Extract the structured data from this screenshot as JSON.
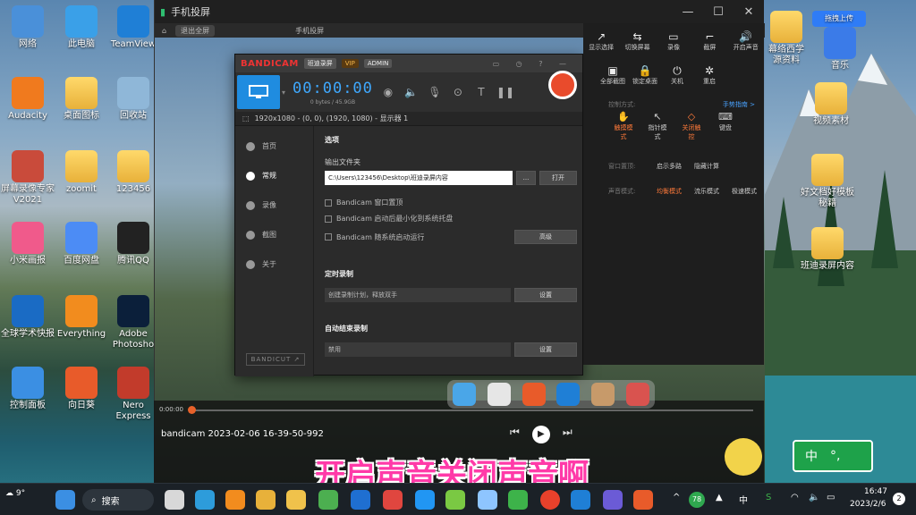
{
  "desktop": {
    "icons_left": [
      {
        "label": "网络",
        "glyph": "net-icon"
      },
      {
        "label": "此电脑",
        "glyph": "pc-icon"
      },
      {
        "label": "TeamView",
        "glyph": "teamviewer-icon"
      },
      {
        "label": "Audacity",
        "glyph": "audacity-icon"
      },
      {
        "label": "桌面图标",
        "glyph": "folder-icon"
      },
      {
        "label": "回收站",
        "glyph": "recycle-icon"
      },
      {
        "label": "屏幕录像专家V2021",
        "glyph": "recorder-icon"
      },
      {
        "label": "zoomit",
        "glyph": "folder-icon"
      },
      {
        "label": "123456",
        "glyph": "folder-icon"
      },
      {
        "label": "小米画报",
        "glyph": "mi-icon"
      },
      {
        "label": "百度网盘",
        "glyph": "baidu-icon"
      },
      {
        "label": "腾讯QQ",
        "glyph": "qq-icon"
      },
      {
        "label": "全球学术快报",
        "glyph": "cnki-icon"
      },
      {
        "label": "Everything",
        "glyph": "everything-icon"
      },
      {
        "label": "Adobe Photosho",
        "glyph": "ps-icon"
      },
      {
        "label": "控制面板",
        "glyph": "control-icon"
      },
      {
        "label": "向日葵",
        "glyph": "sunflower-icon"
      },
      {
        "label": "Nero Express",
        "glyph": "nero-icon"
      }
    ],
    "icons_right": [
      {
        "label": "幕络西学\n源资料",
        "glyph": "folder-icon"
      },
      {
        "label": "音乐",
        "glyph": "music-icon"
      },
      {
        "label": "视频素材",
        "glyph": "folder-icon"
      },
      {
        "label": "好文档好模板\n秘籍",
        "glyph": "folder-icon"
      },
      {
        "label": "班迪录屏内容",
        "glyph": "folder-icon"
      }
    ],
    "baidu_upload": "拖拽上传"
  },
  "mirror_window": {
    "title": "手机投屏",
    "inner_title": "手机投屏",
    "inner_chip": "退出全屏"
  },
  "bandicam": {
    "logo": "BANDICAM",
    "product": "班迪录屏",
    "vip": "VIP",
    "user": "ADMIN",
    "timer": "00:00:00",
    "size": "0 bytes / 45.9GB",
    "resolution": "1920x1080 - (0, 0), (1920, 1080) - 显示器 1",
    "nav": [
      {
        "label": "首页",
        "active": false
      },
      {
        "label": "常规",
        "active": true
      },
      {
        "label": "录像",
        "active": false
      },
      {
        "label": "截图",
        "active": false
      },
      {
        "label": "关于",
        "active": false
      }
    ],
    "bandicut": "BANDICUT ↗",
    "section_options": "选项",
    "output_folder_label": "输出文件夹",
    "output_folder_value": "C:\\Users\\123456\\Desktop\\班迪录屏内容",
    "browse_btn": "...",
    "open_btn": "打开",
    "checks": [
      "Bandicam 窗口置顶",
      "Bandicam 启动后最小化到系统托盘",
      "Bandicam 随系统启动运行"
    ],
    "advanced_btn": "高级",
    "section_schedule": "定时录制",
    "schedule_value": "创建录制计划，释放双手",
    "schedule_btn": "设置",
    "section_autostop": "自动结束录制",
    "autostop_value": "禁用",
    "autostop_btn": "设置"
  },
  "control_panel": {
    "top": [
      {
        "label": "显示选择",
        "glyph": "↗"
      },
      {
        "label": "切换屏幕",
        "glyph": "⇆"
      },
      {
        "label": "录像",
        "glyph": "▭"
      },
      {
        "label": "截屏",
        "glyph": "⌐"
      },
      {
        "label": "开启声音",
        "glyph": "🔊"
      }
    ],
    "second": [
      {
        "label": "全部截图",
        "glyph": "▣"
      },
      {
        "label": "锁定桌面",
        "glyph": "🔒"
      },
      {
        "label": "关机",
        "glyph": "⏻"
      },
      {
        "label": "重启",
        "glyph": "✲"
      }
    ],
    "control_mode_label": "控制方式:",
    "control_mode_link": "手势指南 >",
    "modes": [
      {
        "label": "触摸模式",
        "glyph": "✋",
        "selected": true
      },
      {
        "label": "指针模式",
        "glyph": "↖",
        "selected": false
      },
      {
        "label": "关闭触控",
        "glyph": "◇",
        "selected": false
      },
      {
        "label": "键盘",
        "glyph": "⌨",
        "selected": false
      }
    ],
    "display_label": "窗口置顶:",
    "display_opts": [
      "启示多路",
      "隐藏计算"
    ],
    "sound_label": "声音模式:",
    "sound_opts": [
      {
        "label": "均衡模式",
        "selected": true
      },
      {
        "label": "流乐模式",
        "selected": false
      },
      {
        "label": "极速模式",
        "selected": false
      }
    ]
  },
  "timeline": {
    "time": "0:00:00",
    "filename": "bandicam 2023-02-06 16-39-50-992"
  },
  "subtitle": "开启声音关闭声音啊",
  "ime": {
    "lang": "中",
    "punct": "°,"
  },
  "taskbar": {
    "weather_temp": "9°",
    "search": "搜索",
    "tray_badge": "78",
    "lang": "中",
    "time": "16:47",
    "date": "2023/2/6",
    "notif": "2"
  },
  "colors": {
    "bandicam_accent": "#3fa9ff",
    "record_red": "#e94b2c",
    "subtitle_pink": "#ff3aa8",
    "selected_orange": "#ff7a3a",
    "ime_green": "#1ea24a"
  }
}
